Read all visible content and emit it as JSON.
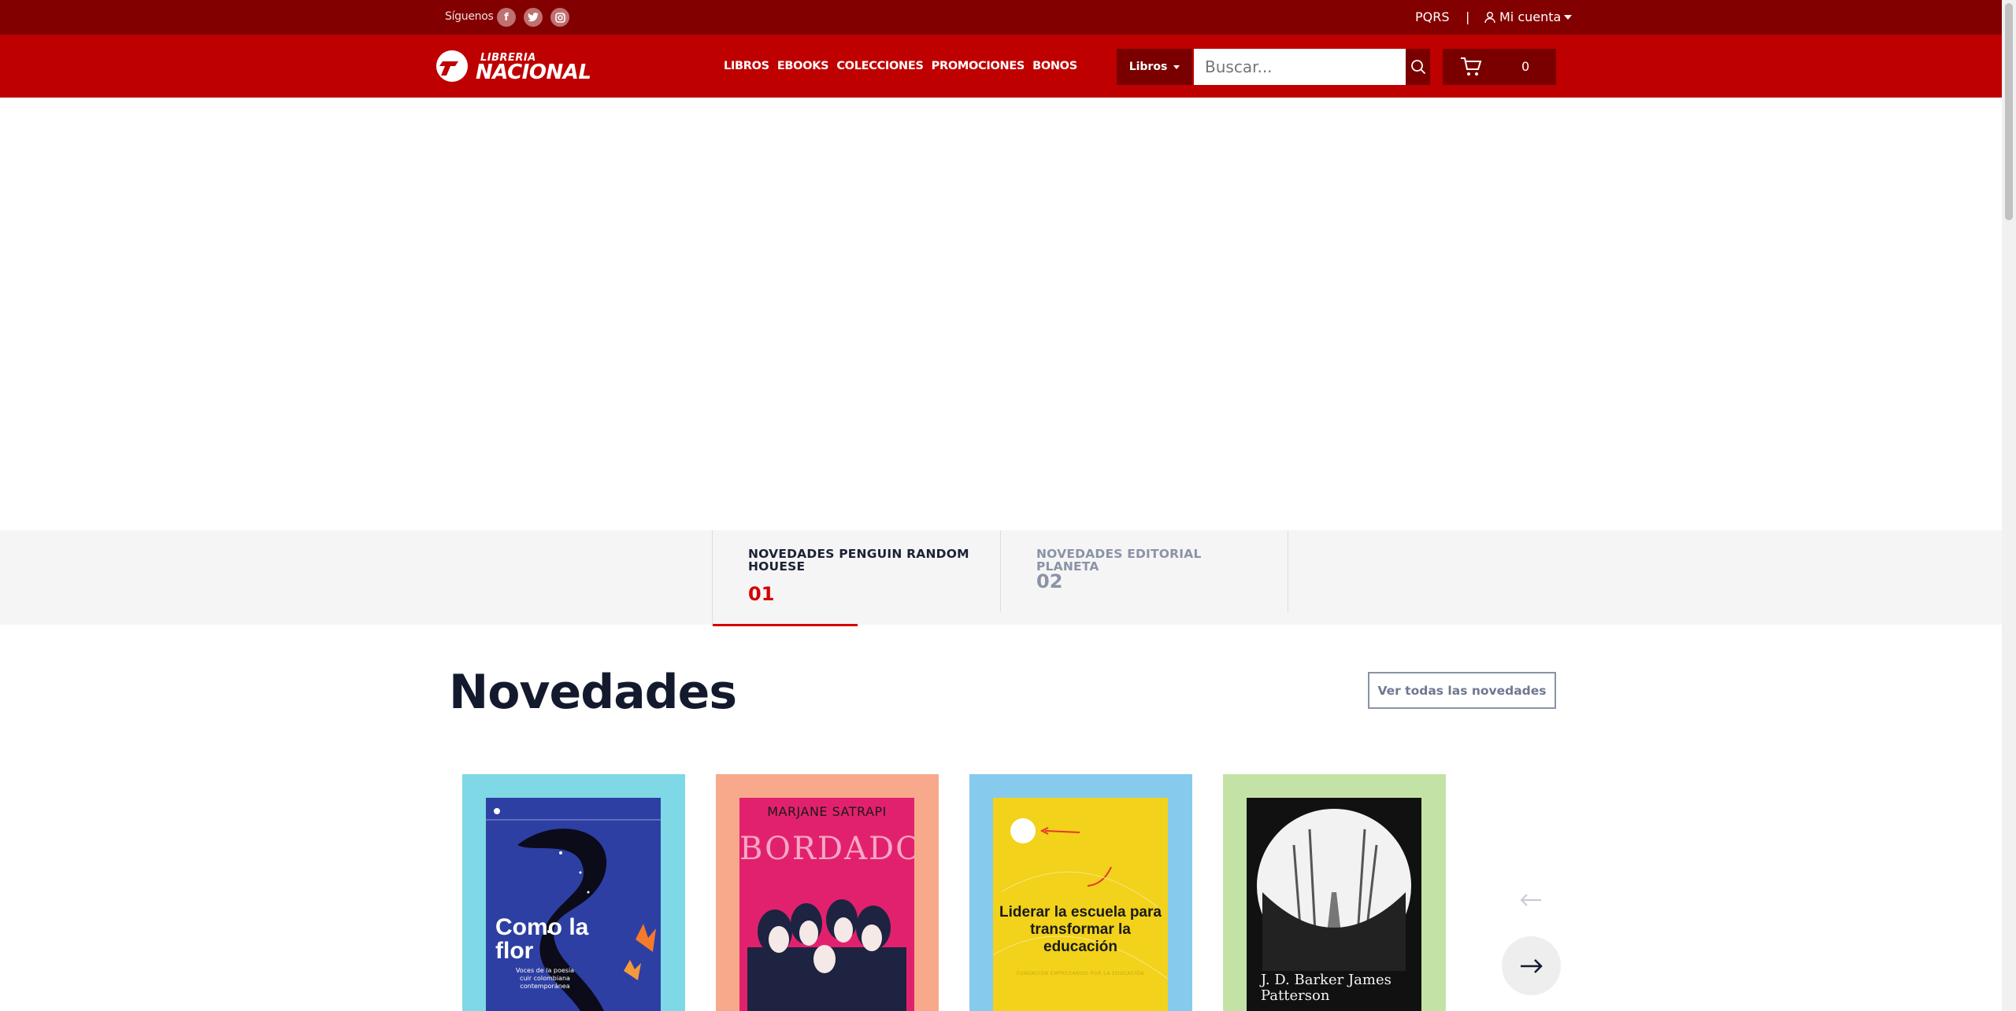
{
  "topbar": {
    "follow_label": "Síguenos",
    "pqrs_label": "PQRS",
    "separator": "|",
    "account_label": "Mi cuenta"
  },
  "header": {
    "logo_line1": "LIBRERIA",
    "logo_line2": "NACIONAL",
    "nav": [
      "LIBROS",
      "EBOOKS",
      "COLECCIONES",
      "PROMOCIONES",
      "BONOS"
    ],
    "category_label": "Libros",
    "search_placeholder": "Buscar...",
    "cart_count": "0"
  },
  "tabs": [
    {
      "title": "NOVEDADES PENGUIN RANDOM HOUESE",
      "number": "01",
      "active": true
    },
    {
      "title": "NOVEDADES EDITORIAL PLANETA",
      "number": "02",
      "active": false
    }
  ],
  "novedades": {
    "title": "Novedades",
    "view_all_label": "Ver todas las novedades"
  },
  "books": [
    {
      "cover_title": "Como la flor",
      "cover_subtitle": "Voces de la poesía cuir colombiana contemporánea",
      "card_color": "#7fd8e5",
      "cover_color": "#2d3fa3"
    },
    {
      "cover_author": "MARJANE SATRAPI",
      "cover_title": "BORDADOS",
      "card_color": "#f8a98c",
      "cover_color": "#e2216e"
    },
    {
      "cover_title": "Liderar la escuela para transformar la educación",
      "cover_subtitle": "FUNDACIÓN EMPRESARIOS POR LA EDUCACIÓN",
      "card_color": "#86cbee",
      "cover_color": "#f2d21a"
    },
    {
      "cover_author": "J. D. Barker James Patterson",
      "card_color": "#c3e3a6",
      "cover_color": "#111111"
    }
  ],
  "colors": {
    "topbar": "#820000",
    "header": "#bf0000",
    "accent": "#d40000",
    "dark_button": "#7a0000"
  }
}
